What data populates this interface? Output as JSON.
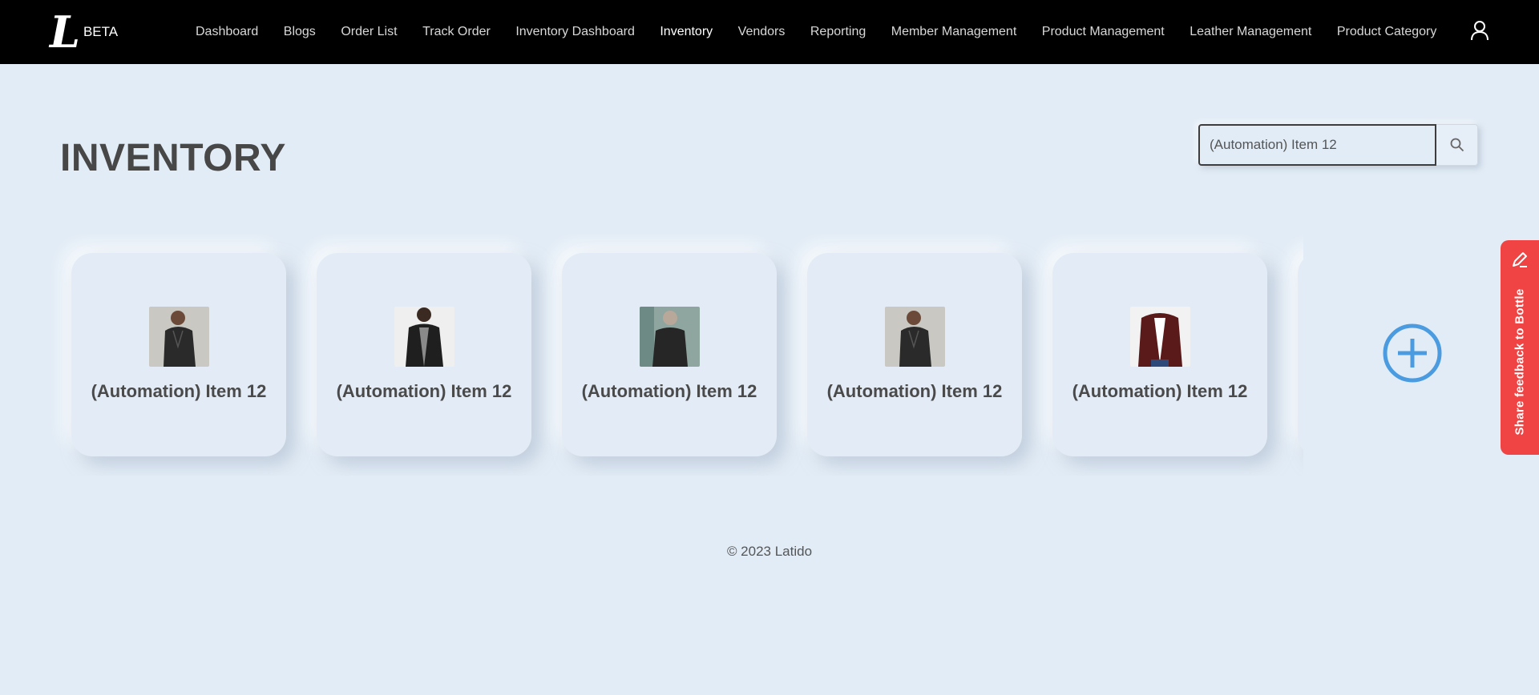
{
  "brand": {
    "logo_letter": "L",
    "badge": "BETA"
  },
  "nav": {
    "items": [
      {
        "label": "Dashboard"
      },
      {
        "label": "Blogs"
      },
      {
        "label": "Order List"
      },
      {
        "label": "Track Order"
      },
      {
        "label": "Inventory Dashboard"
      },
      {
        "label": "Inventory"
      },
      {
        "label": "Vendors"
      },
      {
        "label": "Reporting"
      },
      {
        "label": "Member Management"
      },
      {
        "label": "Product Management"
      },
      {
        "label": "Leather Management"
      },
      {
        "label": "Product Category"
      }
    ],
    "active": "Inventory",
    "user_icon": "user-icon"
  },
  "page": {
    "title": "INVENTORY"
  },
  "search": {
    "value": "(Automation) Item 12",
    "icon": "search-icon"
  },
  "items": [
    {
      "title": "(Automation) Item 12",
      "image": "black leather jacket, woman, side view"
    },
    {
      "title": "(Automation) Item 12",
      "image": "black biker jacket, front view"
    },
    {
      "title": "(Automation) Item 12",
      "image": "black leather jacket, man, outdoor"
    },
    {
      "title": "(Automation) Item 12",
      "image": "black leather jacket, woman, side view"
    },
    {
      "title": "(Automation) Item 12",
      "image": "burgundy leather jacket, front view"
    }
  ],
  "add_button": {
    "icon": "plus-circle-icon"
  },
  "footer": {
    "text": "© 2023 Latido"
  },
  "feedback": {
    "label": "Share feedback to Bottle",
    "icon": "pencil-icon"
  },
  "colors": {
    "navbar": "#000000",
    "background": "#e2ecf6",
    "accent": "#4a9be0",
    "feedback": "#f04444"
  }
}
